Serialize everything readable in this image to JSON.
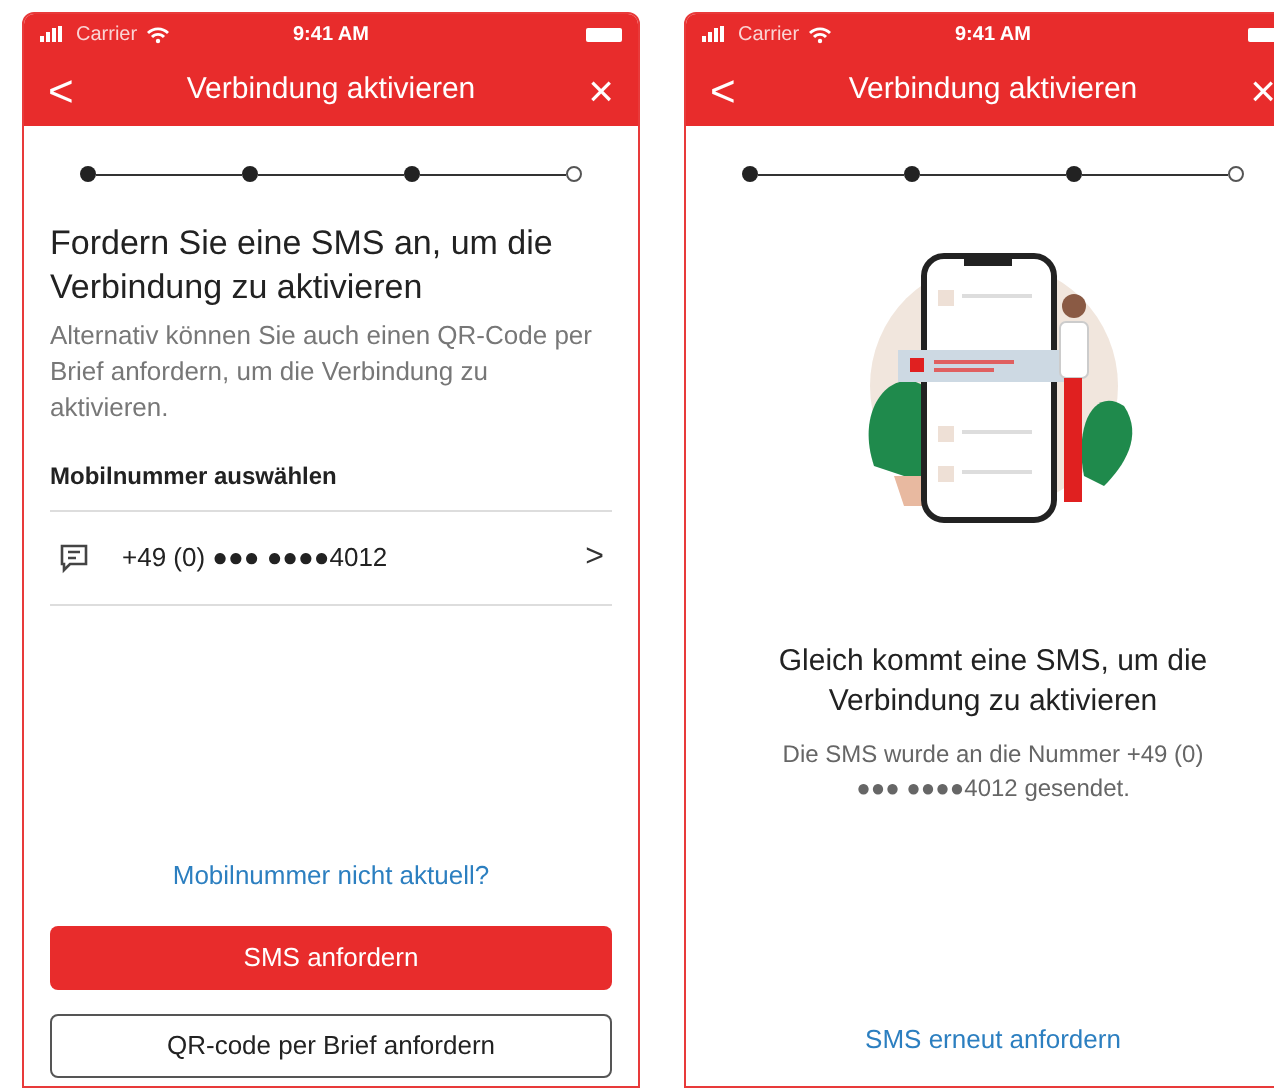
{
  "screens": [
    {
      "status_bar": {
        "carrier": "Carrier",
        "time": "9:41 AM"
      },
      "header": {
        "back": "<",
        "title": "Verbindung aktivieren",
        "close": "×"
      },
      "steps": [
        {
          "done": true
        },
        {
          "done": true
        },
        {
          "done": true
        },
        {
          "done": false
        }
      ],
      "kind": "form",
      "heading": "Fordern Sie eine SMS an, um die Verbindung zu aktivieren",
      "description": "Alternativ können Sie auch einen QR-Code per Brief anfordern, um die Verbindung zu aktivieren.",
      "section_label": "Mobilnummer auswählen",
      "number_row": {
        "number": "+49 (0) ●●● ●●●●4012",
        "chevron": ">"
      },
      "link": "Mobilnummer nicht aktuell?",
      "primary_button": "SMS anfordern",
      "secondary_button": "QR-code per Brief anfordern"
    },
    {
      "status_bar": {
        "carrier": "Carrier",
        "time": "9:41 AM"
      },
      "header": {
        "back": "<",
        "title": "Verbindung aktivieren",
        "close": "×"
      },
      "steps": [
        {
          "done": true
        },
        {
          "done": true
        },
        {
          "done": true
        },
        {
          "done": false
        }
      ],
      "kind": "confirmation",
      "heading": "Gleich kommt eine SMS, um die Verbindung zu aktivieren",
      "description": "Die SMS wurde an die Nummer +49 (0) ●●● ●●●●4012 gesendet.",
      "link": "SMS erneut anfordern"
    }
  ]
}
